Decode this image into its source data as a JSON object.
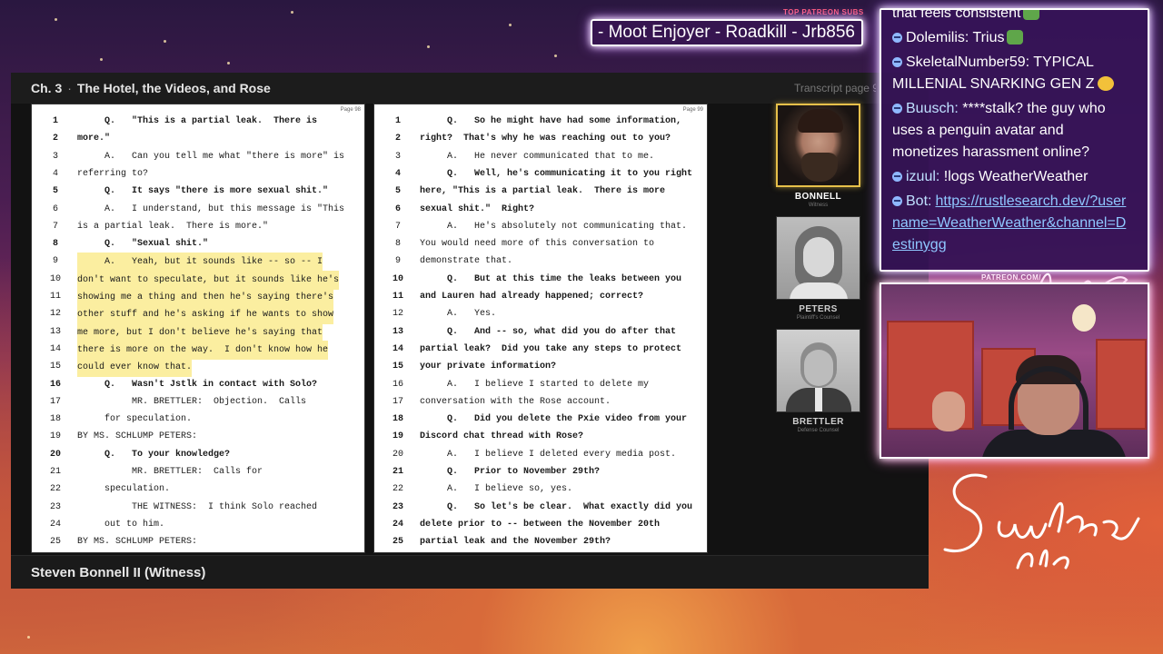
{
  "stream": {
    "top_subs_label": "TOP PATREON SUBS",
    "top_subs_text": "- Moot Enjoyer - Roadkill - Jrb856",
    "patreon_tag": "PATREON.COM/"
  },
  "player": {
    "chapter_number": "Ch. 3",
    "chapter_separator": "·",
    "chapter_title": "The Hotel, the Videos, and Rose",
    "page_counter": "Transcript page 9",
    "footer_speaker": "Steven Bonnell II (Witness)"
  },
  "transcript_left": {
    "page_label": "Page 98",
    "lines": [
      {
        "n": "1",
        "text": "     Q.   \"This is a partial leak.  There is",
        "bold": true,
        "hl": false
      },
      {
        "n": "2",
        "text": "more.\"",
        "bold": true,
        "hl": false
      },
      {
        "n": "3",
        "text": "     A.   Can you tell me what \"there is more\" is",
        "bold": false,
        "hl": false
      },
      {
        "n": "4",
        "text": "referring to?",
        "bold": false,
        "hl": false
      },
      {
        "n": "5",
        "text": "     Q.   It says \"there is more sexual shit.\"",
        "bold": true,
        "hl": false
      },
      {
        "n": "6",
        "text": "     A.   I understand, but this message is \"This",
        "bold": false,
        "hl": false
      },
      {
        "n": "7",
        "text": "is a partial leak.  There is more.\"",
        "bold": false,
        "hl": false
      },
      {
        "n": "8",
        "text": "     Q.   \"Sexual shit.\"",
        "bold": true,
        "hl": false
      },
      {
        "n": "9",
        "text": "     A.   Yeah, but it sounds like -- so -- I",
        "bold": false,
        "hl": true
      },
      {
        "n": "10",
        "text": "don't want to speculate, but it sounds like he's",
        "bold": false,
        "hl": true
      },
      {
        "n": "11",
        "text": "showing me a thing and then he's saying there's",
        "bold": false,
        "hl": true
      },
      {
        "n": "12",
        "text": "other stuff and he's asking if he wants to show",
        "bold": false,
        "hl": true
      },
      {
        "n": "13",
        "text": "me more, but I don't believe he's saying that",
        "bold": false,
        "hl": true
      },
      {
        "n": "14",
        "text": "there is more on the way.  I don't know how he",
        "bold": false,
        "hl": true
      },
      {
        "n": "15",
        "text": "could ever know that.",
        "bold": false,
        "hl": true
      },
      {
        "n": "16",
        "text": "     Q.   Wasn't Jstlk in contact with Solo?",
        "bold": true,
        "hl": false
      },
      {
        "n": "17",
        "text": "          MR. BRETTLER:  Objection.  Calls",
        "bold": false,
        "hl": false
      },
      {
        "n": "18",
        "text": "     for speculation.",
        "bold": false,
        "hl": false
      },
      {
        "n": "19",
        "text": "BY MS. SCHLUMP PETERS:",
        "bold": false,
        "hl": false
      },
      {
        "n": "20",
        "text": "     Q.   To your knowledge?",
        "bold": true,
        "hl": false
      },
      {
        "n": "21",
        "text": "          MR. BRETTLER:  Calls for",
        "bold": false,
        "hl": false
      },
      {
        "n": "22",
        "text": "     speculation.",
        "bold": false,
        "hl": false
      },
      {
        "n": "23",
        "text": "          THE WITNESS:  I think Solo reached",
        "bold": false,
        "hl": false
      },
      {
        "n": "24",
        "text": "     out to him.",
        "bold": false,
        "hl": false
      },
      {
        "n": "25",
        "text": "BY MS. SCHLUMP PETERS:",
        "bold": false,
        "hl": false
      }
    ]
  },
  "transcript_right": {
    "page_label": "Page 99",
    "lines": [
      {
        "n": "1",
        "text": "     Q.   So he might have had some information,",
        "bold": true,
        "hl": false
      },
      {
        "n": "2",
        "text": "right?  That's why he was reaching out to you?",
        "bold": true,
        "hl": false
      },
      {
        "n": "3",
        "text": "     A.   He never communicated that to me.",
        "bold": false,
        "hl": false
      },
      {
        "n": "4",
        "text": "     Q.   Well, he's communicating it to you right",
        "bold": true,
        "hl": false
      },
      {
        "n": "5",
        "text": "here, \"This is a partial leak.  There is more",
        "bold": true,
        "hl": false
      },
      {
        "n": "6",
        "text": "sexual shit.\"  Right?",
        "bold": true,
        "hl": false
      },
      {
        "n": "7",
        "text": "     A.   He's absolutely not communicating that.",
        "bold": false,
        "hl": false
      },
      {
        "n": "8",
        "text": "You would need more of this conversation to",
        "bold": false,
        "hl": false
      },
      {
        "n": "9",
        "text": "demonstrate that.",
        "bold": false,
        "hl": false
      },
      {
        "n": "10",
        "text": "     Q.   But at this time the leaks between you",
        "bold": true,
        "hl": false
      },
      {
        "n": "11",
        "text": "and Lauren had already happened; correct?",
        "bold": true,
        "hl": false
      },
      {
        "n": "12",
        "text": "     A.   Yes.",
        "bold": false,
        "hl": false
      },
      {
        "n": "13",
        "text": "     Q.   And -- so, what did you do after that",
        "bold": true,
        "hl": false
      },
      {
        "n": "14",
        "text": "partial leak?  Did you take any steps to protect",
        "bold": true,
        "hl": false
      },
      {
        "n": "15",
        "text": "your private information?",
        "bold": true,
        "hl": false
      },
      {
        "n": "16",
        "text": "     A.   I believe I started to delete my",
        "bold": false,
        "hl": false
      },
      {
        "n": "17",
        "text": "conversation with the Rose account.",
        "bold": false,
        "hl": false
      },
      {
        "n": "18",
        "text": "     Q.   Did you delete the Pxie video from your",
        "bold": true,
        "hl": false
      },
      {
        "n": "19",
        "text": "Discord chat thread with Rose?",
        "bold": true,
        "hl": false
      },
      {
        "n": "20",
        "text": "     A.   I believe I deleted every media post.",
        "bold": false,
        "hl": false
      },
      {
        "n": "21",
        "text": "     Q.   Prior to November 29th?",
        "bold": true,
        "hl": false
      },
      {
        "n": "22",
        "text": "     A.   I believe so, yes.",
        "bold": false,
        "hl": false
      },
      {
        "n": "23",
        "text": "     Q.   So let's be clear.  What exactly did you",
        "bold": true,
        "hl": false
      },
      {
        "n": "24",
        "text": "delete prior to -- between the November 20th",
        "bold": true,
        "hl": false
      },
      {
        "n": "25",
        "text": "partial leak and the November 29th?",
        "bold": true,
        "hl": false
      }
    ]
  },
  "speakers": [
    {
      "name": "BONNELL",
      "role": "Witness",
      "active": true
    },
    {
      "name": "PETERS",
      "role": "Plaintiff's Counsel",
      "active": false
    },
    {
      "name": "BRETTLER",
      "role": "Defense Counsel",
      "active": false
    }
  ],
  "chat": {
    "messages": [
      {
        "user": "",
        "text": "that feels consistent",
        "emote": "green"
      },
      {
        "user": "Dolemilis:",
        "text": " Trius",
        "emote": "green"
      },
      {
        "user": "SkeletalNumber59:",
        "text": " TYPICAL MILLENIAL SNARKING GEN Z",
        "emote": "yellow"
      },
      {
        "user": "Buusch:",
        "text": " ****stalk? the guy who uses a penguin avatar and monetizes harassment online?",
        "emote": ""
      },
      {
        "user": "izuul:",
        "text": " !logs WeatherWeather",
        "emote": ""
      },
      {
        "user": "Bot:",
        "text": "",
        "link": "https://rustlesearch.dev/?username=WeatherWeather&channel=Destinygg",
        "emote": ""
      }
    ]
  },
  "colors": {
    "highlight": "#fbeea0",
    "active_speaker_border": "#e6c04a",
    "chat_bg": "#361458",
    "neon_glow": "#b873ff"
  },
  "icons": [
    "chat-user-badge-icon",
    "pepe-emote-icon",
    "yellow-emote-icon"
  ]
}
